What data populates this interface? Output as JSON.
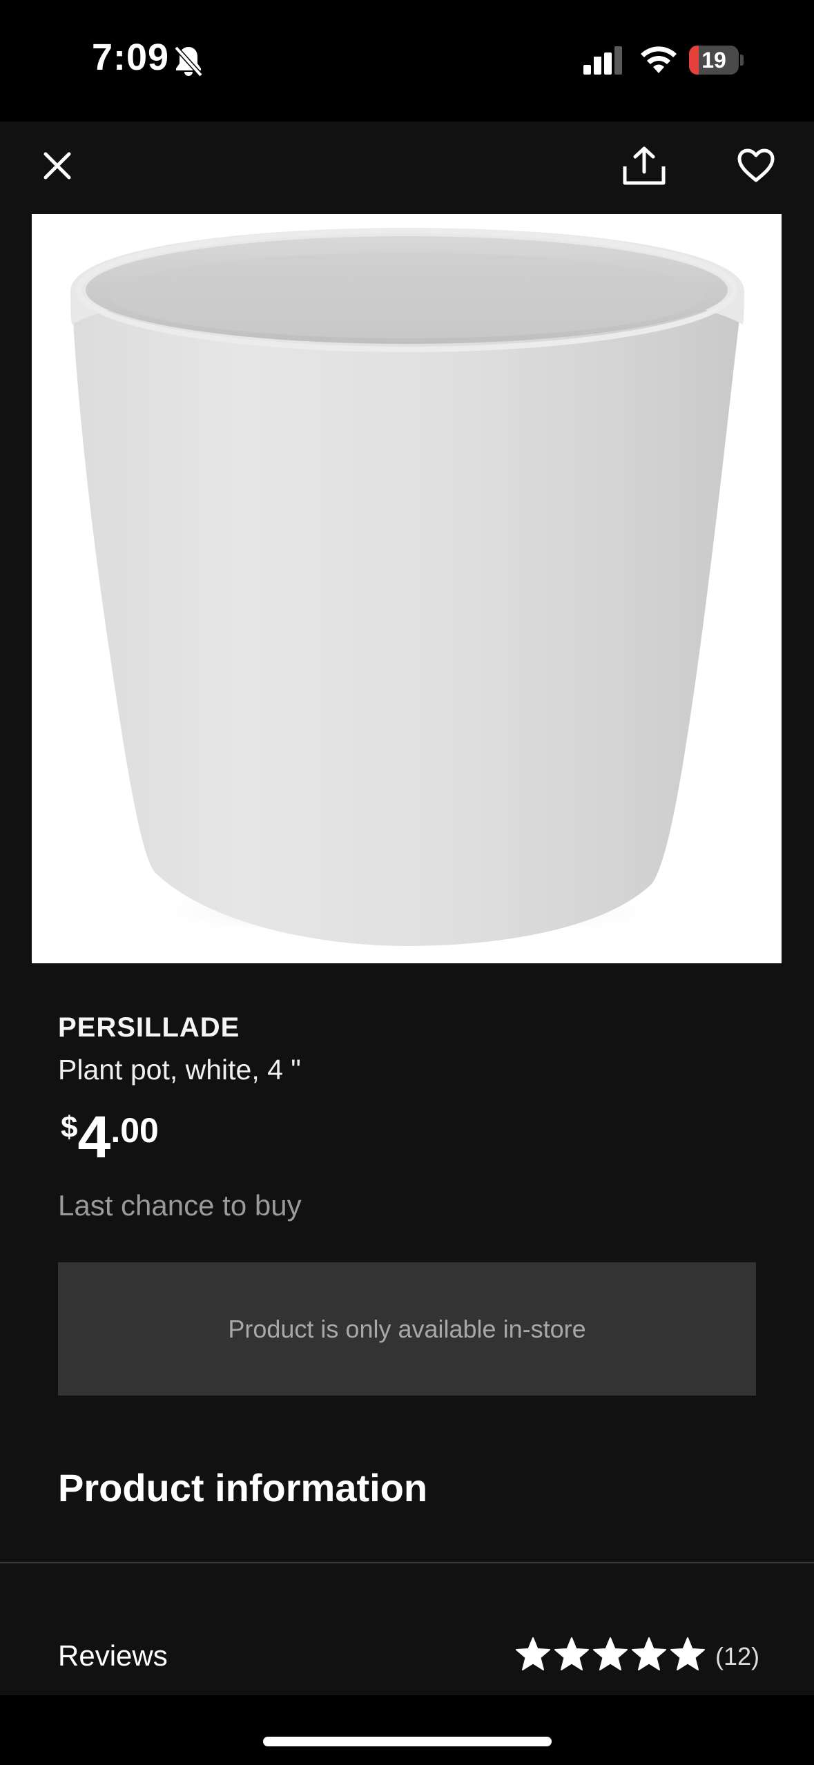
{
  "status_bar": {
    "time": "7:09",
    "battery_level": "19",
    "battery_fraction": 0.19,
    "icons": [
      "bell-slash-icon",
      "cellular-signal-icon",
      "wifi-icon",
      "battery-icon"
    ]
  },
  "top_bar": {
    "icons": [
      "close-icon",
      "share-icon",
      "heart-icon"
    ]
  },
  "product": {
    "brand": "PERSILLADE",
    "description": "Plant pot, white, 4 \"",
    "price": {
      "currency": "$",
      "integer": "4",
      "decimal": ".00"
    },
    "availability_note": "Last chance to buy",
    "store_notice": "Product is only available in-store"
  },
  "sections": {
    "product_information": "Product information",
    "reviews_label": "Reviews",
    "reviews_count": "(12)",
    "rating_stars": 5
  },
  "colors": {
    "background": "#111111",
    "status_bar": "#000000",
    "notice_box": "#333333",
    "battery_low": "#e5403a"
  }
}
